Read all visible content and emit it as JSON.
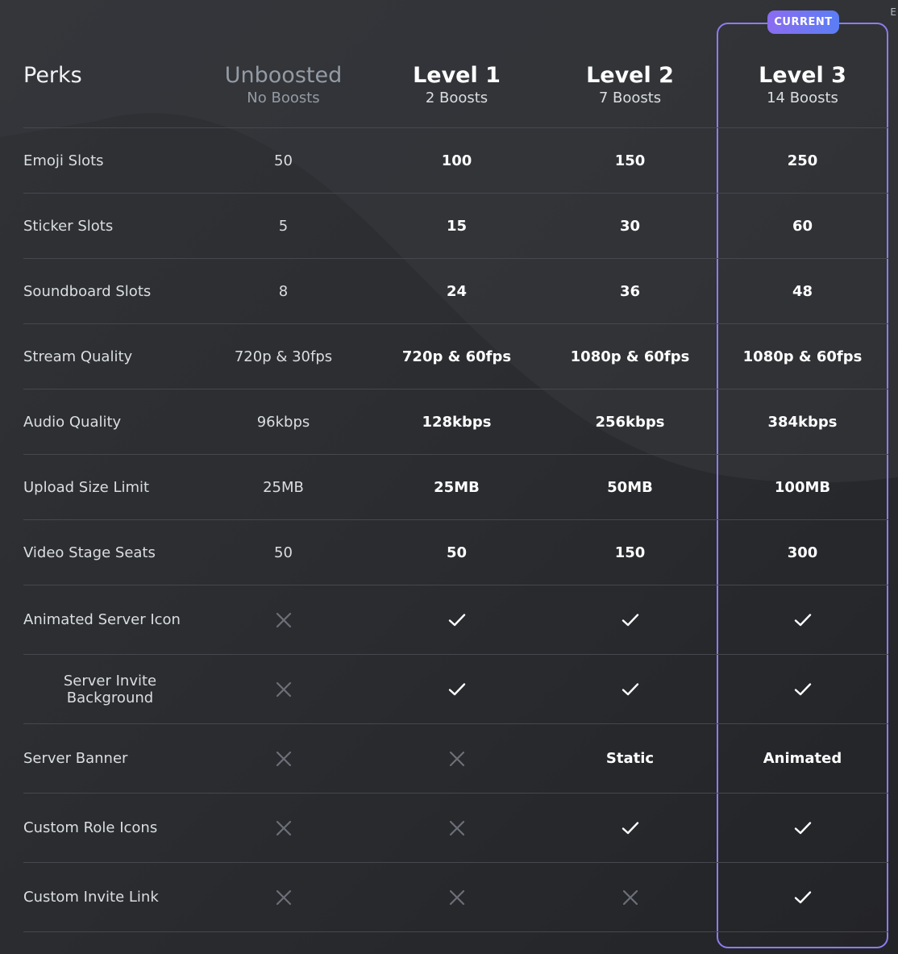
{
  "header": {
    "perks_label": "Perks",
    "columns": [
      {
        "title": "Unboosted",
        "subtitle": "No Boosts"
      },
      {
        "title": "Level 1",
        "subtitle": "2 Boosts"
      },
      {
        "title": "Level 2",
        "subtitle": "7 Boosts"
      },
      {
        "title": "Level 3",
        "subtitle": "14 Boosts"
      }
    ],
    "current_badge": "CURRENT",
    "corner_char": "E"
  },
  "rows": [
    {
      "perk": "Emoji Slots",
      "values": [
        "50",
        "100",
        "150",
        "250"
      ]
    },
    {
      "perk": "Sticker Slots",
      "values": [
        "5",
        "15",
        "30",
        "60"
      ]
    },
    {
      "perk": "Soundboard Slots",
      "values": [
        "8",
        "24",
        "36",
        "48"
      ]
    },
    {
      "perk": "Stream Quality",
      "values": [
        "720p & 30fps",
        "720p & 60fps",
        "1080p & 60fps",
        "1080p & 60fps"
      ]
    },
    {
      "perk": "Audio Quality",
      "values": [
        "96kbps",
        "128kbps",
        "256kbps",
        "384kbps"
      ]
    },
    {
      "perk": "Upload Size Limit",
      "values": [
        "25MB",
        "25MB",
        "50MB",
        "100MB"
      ]
    },
    {
      "perk": "Video Stage Seats",
      "values": [
        "50",
        "50",
        "150",
        "300"
      ]
    },
    {
      "perk": "Animated Server Icon",
      "values": [
        "cross-icon",
        "check-icon",
        "check-icon",
        "check-icon"
      ]
    },
    {
      "perk": "Server Invite Background",
      "values": [
        "cross-icon",
        "check-icon",
        "check-icon",
        "check-icon"
      ]
    },
    {
      "perk": "Server Banner",
      "values": [
        "cross-icon",
        "cross-icon",
        "Static",
        "Animated"
      ]
    },
    {
      "perk": "Custom Role Icons",
      "values": [
        "cross-icon",
        "cross-icon",
        "check-icon",
        "check-icon"
      ]
    },
    {
      "perk": "Custom Invite Link",
      "values": [
        "cross-icon",
        "cross-icon",
        "cross-icon",
        "check-icon"
      ]
    }
  ],
  "colors": {
    "current_border": "#8c7cf0",
    "badge_gradient_start": "#8b6cf0",
    "badge_gradient_end": "#5b7ef5",
    "cross_icon": "#6d6f78",
    "check_icon": "#ffffff"
  }
}
